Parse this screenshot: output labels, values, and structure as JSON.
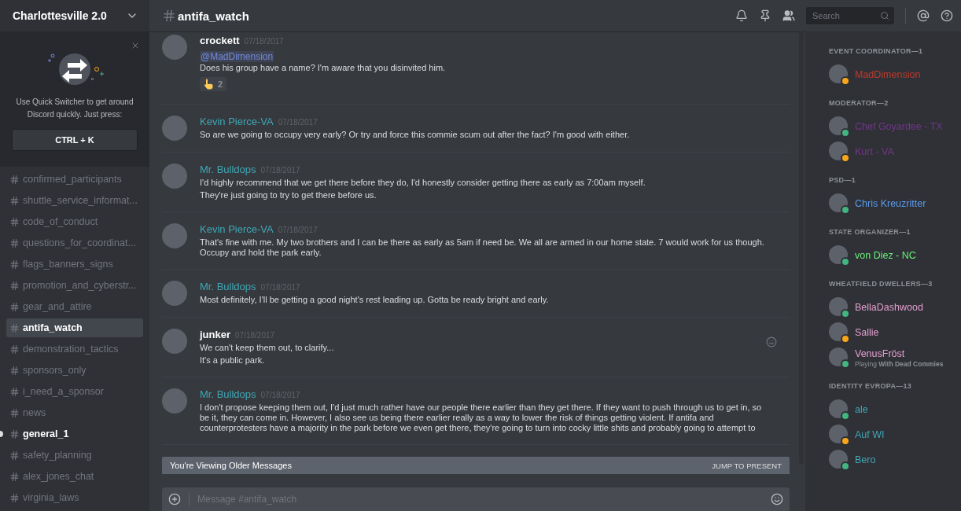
{
  "server": {
    "name": "Charlottesville 2.0"
  },
  "quick_switcher": {
    "text": "Use Quick Switcher to get around Discord quickly. Just press:",
    "shortcut": "CTRL + K"
  },
  "channels": [
    {
      "name": "confirmed_participants",
      "selected": false,
      "unread": false
    },
    {
      "name": "shuttle_service_informat...",
      "selected": false,
      "unread": false
    },
    {
      "name": "code_of_conduct",
      "selected": false,
      "unread": false
    },
    {
      "name": "questions_for_coordinat...",
      "selected": false,
      "unread": false
    },
    {
      "name": "flags_banners_signs",
      "selected": false,
      "unread": false
    },
    {
      "name": "promotion_and_cyberstr...",
      "selected": false,
      "unread": false
    },
    {
      "name": "gear_and_attire",
      "selected": false,
      "unread": false
    },
    {
      "name": "antifa_watch",
      "selected": true,
      "unread": false
    },
    {
      "name": "demonstration_tactics",
      "selected": false,
      "unread": false
    },
    {
      "name": "sponsors_only",
      "selected": false,
      "unread": false
    },
    {
      "name": "i_need_a_sponsor",
      "selected": false,
      "unread": false
    },
    {
      "name": "news",
      "selected": false,
      "unread": false
    },
    {
      "name": "general_1",
      "selected": false,
      "unread": true
    },
    {
      "name": "safety_planning",
      "selected": false,
      "unread": false
    },
    {
      "name": "alex_jones_chat",
      "selected": false,
      "unread": false
    },
    {
      "name": "virginia_laws",
      "selected": false,
      "unread": false
    }
  ],
  "header": {
    "channel": "antifa_watch",
    "search_placeholder": "Search"
  },
  "messages": [
    {
      "author": "crockett",
      "color": "#ffffff",
      "date": "07/18/2017",
      "mention": "@MadDimension",
      "lines": [
        "Does his group have a name? I'm aware that you disinvited him."
      ],
      "reaction": {
        "count": "2"
      }
    },
    {
      "author": "Kevin Pierce-VA",
      "color": "#3fa7b5",
      "date": "07/18/2017",
      "lines": [
        "So are we going to occupy very early? Or try and force this commie scum out after the fact? I'm good with either."
      ]
    },
    {
      "author": "Mr. Bulldops",
      "color": "#3fa7b5",
      "date": "07/18/2017",
      "lines": [
        "I'd highly recommend that we get there before they do, I'd honestly consider getting there as early as 7:00am myself.",
        "They're just going to try to get there before us."
      ]
    },
    {
      "author": "Kevin Pierce-VA",
      "color": "#3fa7b5",
      "date": "07/18/2017",
      "lines": [
        "That's fine with me. My two brothers and I can be there as early as 5am if need be. We all are armed in our home state. 7 would work for us though. Occupy and hold the park early."
      ]
    },
    {
      "author": "Mr. Bulldops",
      "color": "#3fa7b5",
      "date": "07/18/2017",
      "lines": [
        "Most definitely, I'll be getting a good night's rest leading up. Gotta be ready bright and early."
      ]
    },
    {
      "author": "junker",
      "color": "#ffffff",
      "date": "07/18/2017",
      "lines": [
        "We can't keep them out, to clarify...",
        "It's a public park."
      ],
      "hovered": true
    },
    {
      "author": "Mr. Bulldops",
      "color": "#3fa7b5",
      "date": "07/18/2017",
      "lines": [
        "I don't propose keeping them out, I'd just much rather have our people there earlier than they get there. If they want to push through us to get in, so be it, they can come in. However, I also see us being there earlier really as a way to lower the risk of things getting violent. If antifa and counterprotesters have a majority in the park before we even get there, they're going to turn into cocky little shits and probably going to attempt to"
      ]
    }
  ],
  "older_bar": {
    "text": "You're Viewing Older Messages",
    "action": "JUMP TO PRESENT"
  },
  "composer": {
    "placeholder": "Message #antifa_watch"
  },
  "member_groups": [
    {
      "title": "EVENT COORDINATOR—1",
      "members": [
        {
          "name": "MadDimension",
          "color": "#c0392b",
          "idle": true
        }
      ]
    },
    {
      "title": "MODERATOR—2",
      "members": [
        {
          "name": "Chef Goyardee - TX",
          "color": "#71368a",
          "idle": false
        },
        {
          "name": "Kurt - VA",
          "color": "#71368a",
          "idle": true
        }
      ]
    },
    {
      "title": "PSD—1",
      "members": [
        {
          "name": "Chris Kreuzritter",
          "color": "#5b9bef",
          "idle": false
        }
      ]
    },
    {
      "title": "STATE ORGANIZER—1",
      "members": [
        {
          "name": "von Diez - NC",
          "color": "#6bf07a",
          "idle": false
        }
      ]
    },
    {
      "title": "WHEATFIELD DWELLERS—3",
      "members": [
        {
          "name": "BellaDashwood",
          "color": "#e69fd0",
          "idle": false
        },
        {
          "name": "Sallie",
          "color": "#e69fd0",
          "idle": true
        },
        {
          "name": "VenusFröst",
          "color": "#e69fd0",
          "idle": false,
          "activity": "Playing **With Dead Commies**"
        }
      ]
    },
    {
      "title": "IDENTITY EVROPA—13",
      "members": [
        {
          "name": "ale",
          "color": "#3fa7b5",
          "idle": false
        },
        {
          "name": "Auf WI",
          "color": "#3fa7b5",
          "idle": true
        },
        {
          "name": "Bero",
          "color": "#3fa7b5",
          "idle": false
        }
      ]
    }
  ]
}
